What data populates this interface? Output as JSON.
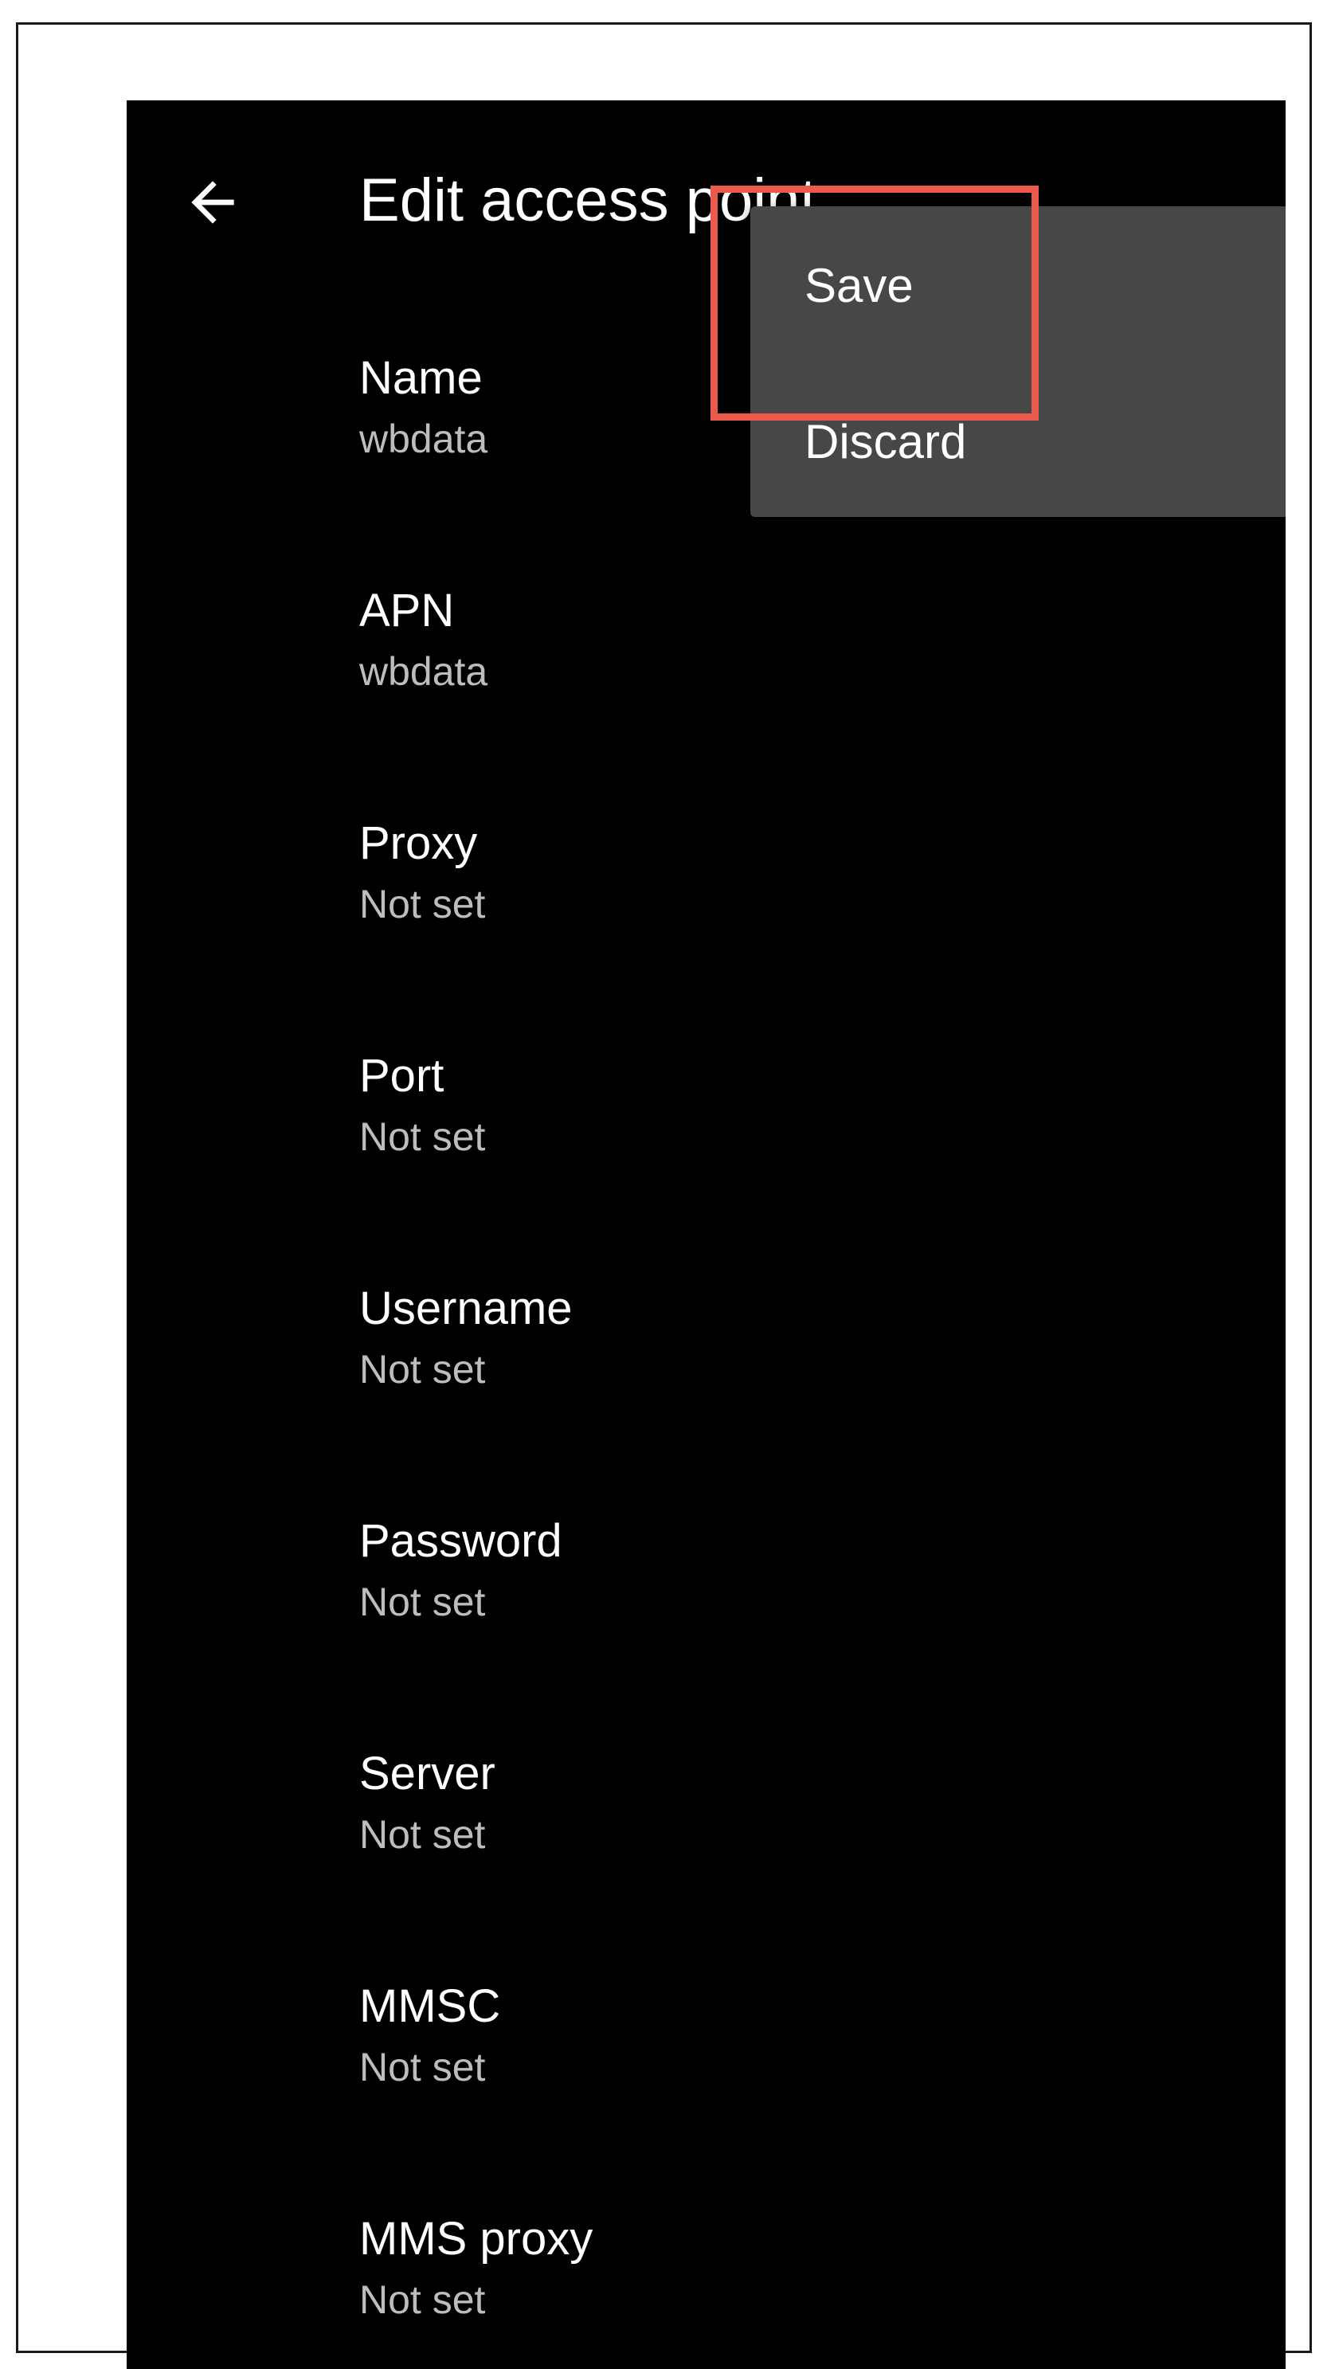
{
  "header": {
    "back_icon": "arrow-left-icon",
    "title": "Edit access point"
  },
  "fields": [
    {
      "label": "Name",
      "value": "wbdata"
    },
    {
      "label": "APN",
      "value": "wbdata"
    },
    {
      "label": "Proxy",
      "value": "Not set"
    },
    {
      "label": "Port",
      "value": "Not set"
    },
    {
      "label": "Username",
      "value": "Not set"
    },
    {
      "label": "Password",
      "value": "Not set"
    },
    {
      "label": "Server",
      "value": "Not set"
    },
    {
      "label": "MMSC",
      "value": "Not set"
    },
    {
      "label": "MMS proxy",
      "value": "Not set"
    }
  ],
  "overflow_menu": {
    "items": [
      {
        "label": "Save"
      },
      {
        "label": "Discard"
      }
    ]
  },
  "annotation": {
    "highlight_color": "#ec5a4e"
  },
  "colors": {
    "screen_background": "#000000",
    "menu_background": "#474747",
    "primary_text": "#ffffff",
    "secondary_text": "#bdbdbd"
  }
}
